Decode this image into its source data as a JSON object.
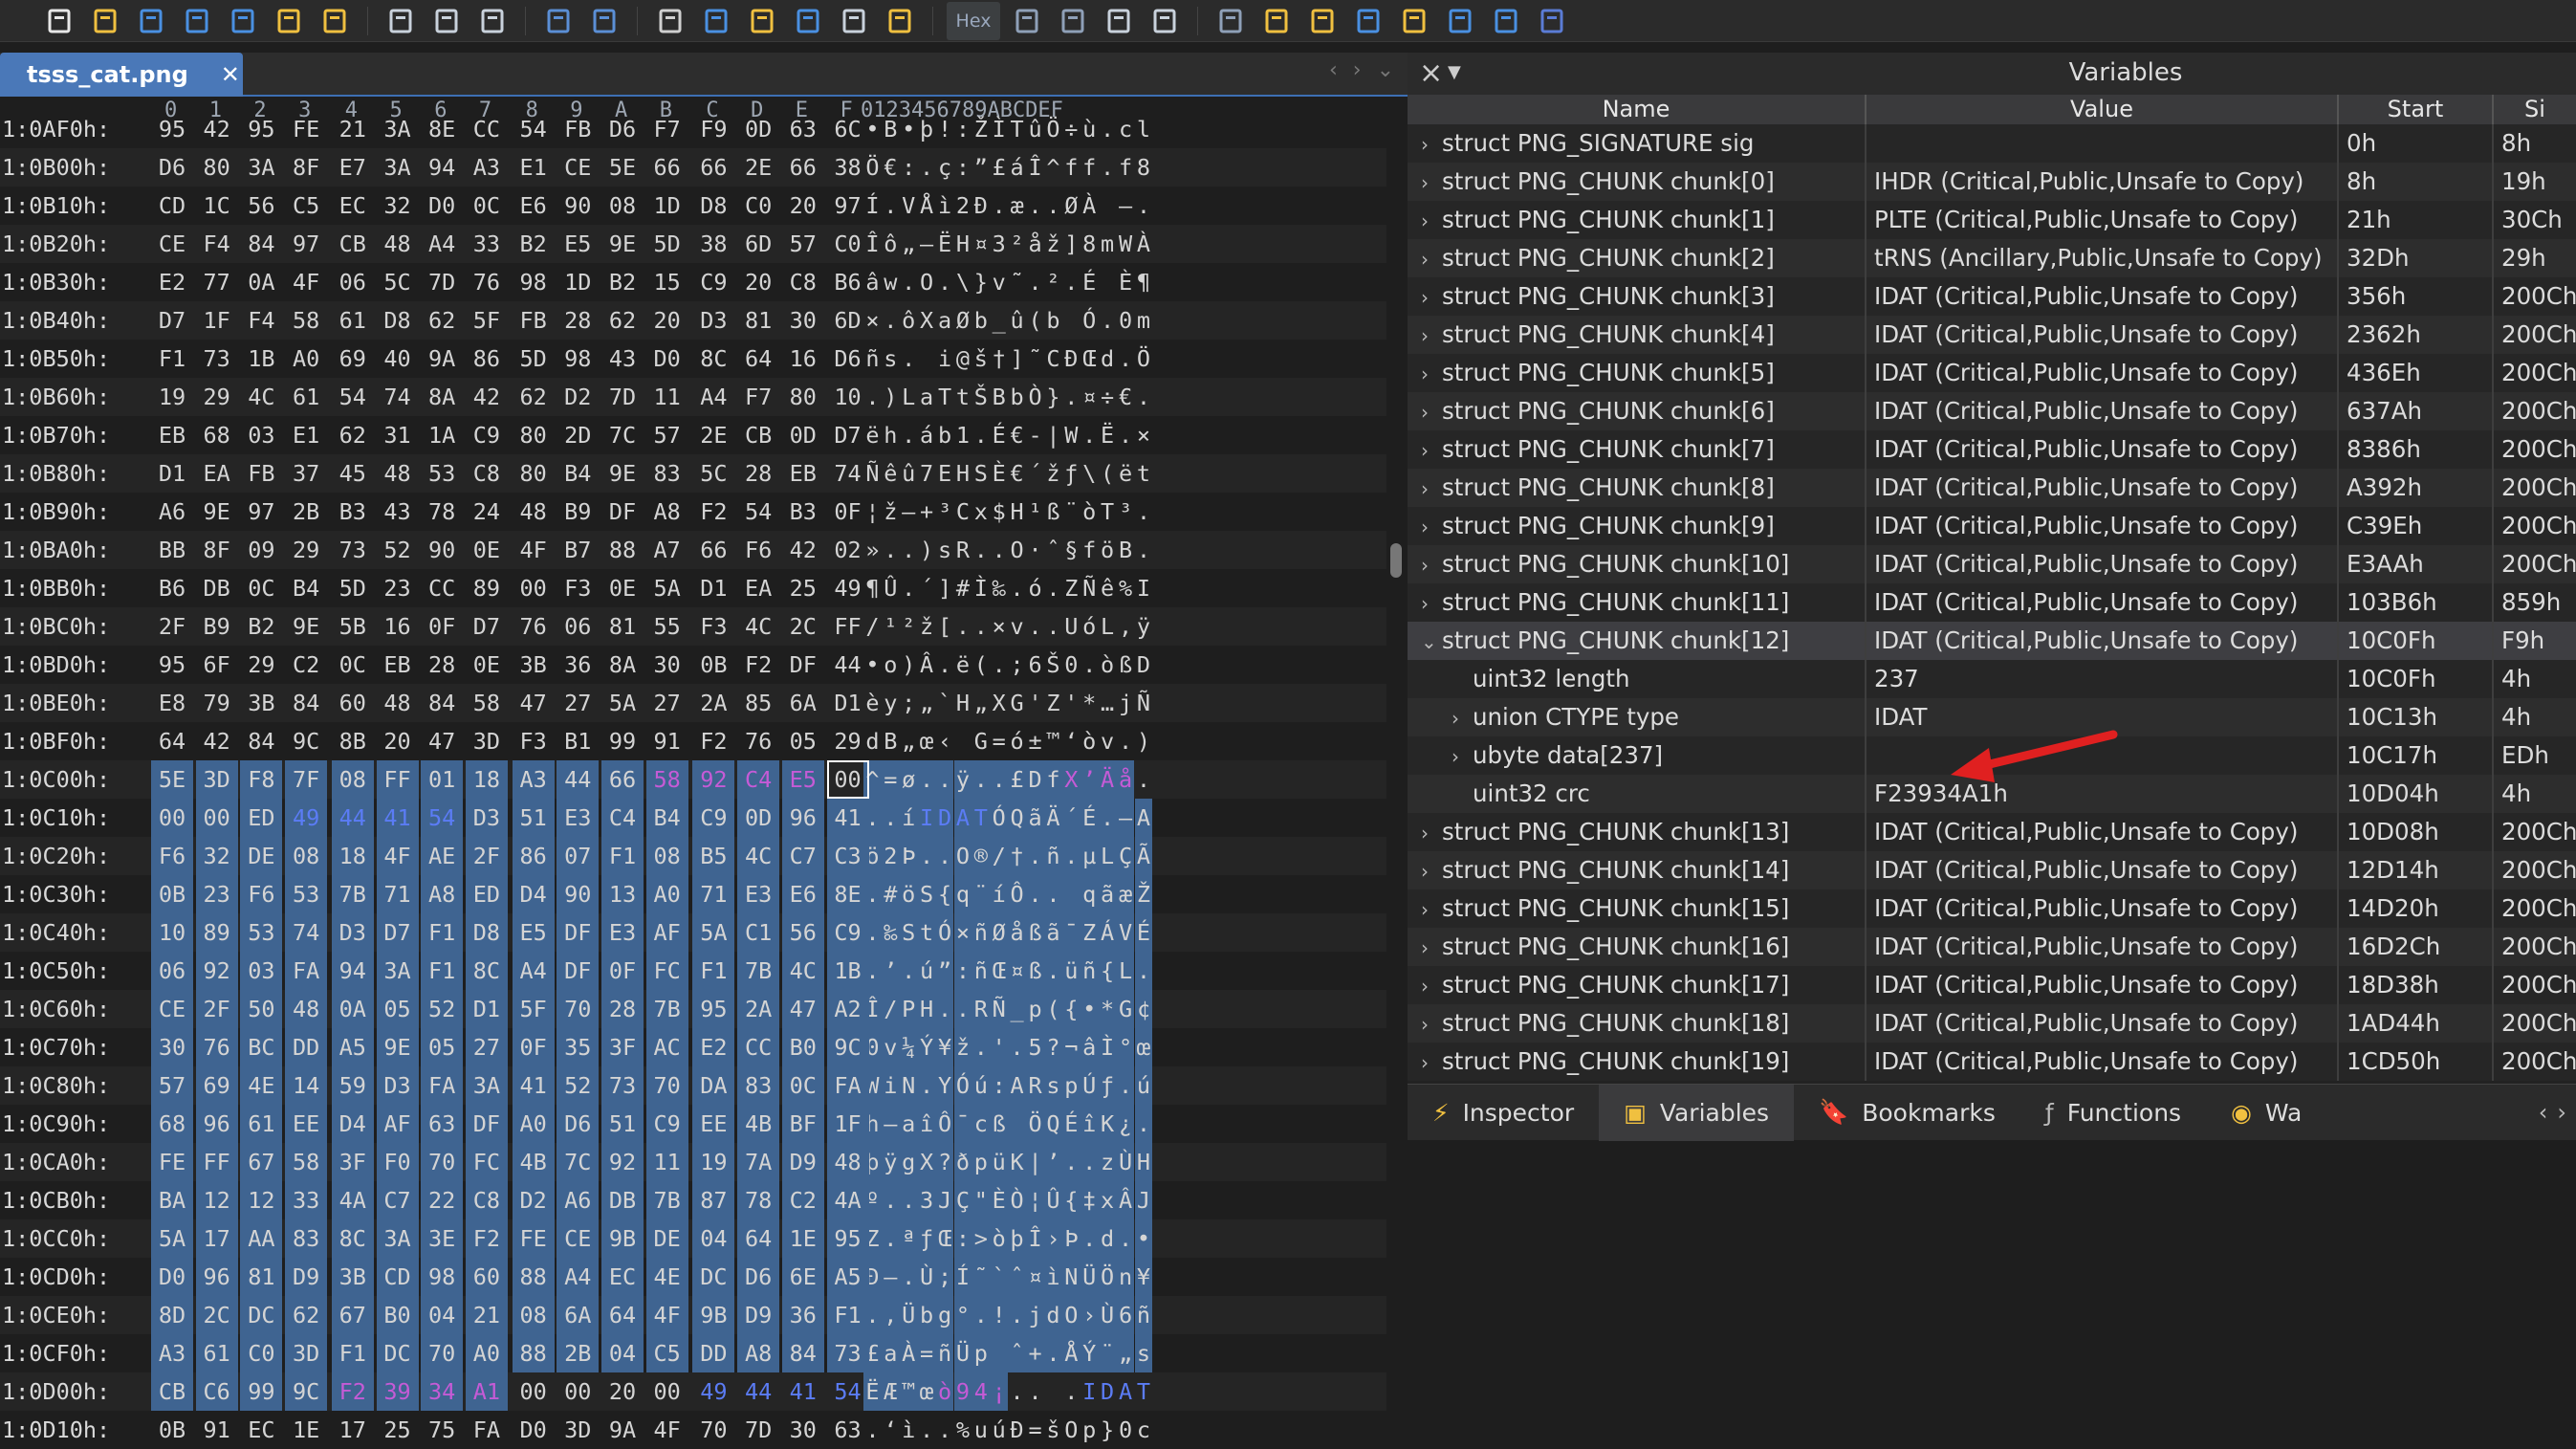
{
  "toolbar": {
    "hex_label": "Hex",
    "icons": [
      "new-file-icon",
      "open-folder-icon",
      "save-icon",
      "save-as-icon",
      "save-all-icon",
      "folder-icon",
      "open-workspace-icon",
      "cut-icon",
      "copy-icon",
      "paste-icon",
      "undo-icon",
      "redo-icon",
      "find-icon",
      "find-replace-icon",
      "find-in-files-icon",
      "goto-icon",
      "bookmark-icon",
      "script-icon",
      "hex-icon",
      "columns-icon",
      "paragraph-icon",
      "table-icon",
      "edit-icon",
      "calculator-icon",
      "inspector-icon",
      "compare-icon",
      "histogram-icon",
      "math-icon",
      "checksum-icon",
      "base-convert-icon",
      "pause-icon"
    ]
  },
  "file_tab": {
    "label": "tsss_cat.png"
  },
  "hex": {
    "col_header": [
      "0",
      "1",
      "2",
      "3",
      "4",
      "5",
      "6",
      "7",
      "8",
      "9",
      "A",
      "B",
      "C",
      "D",
      "E",
      "F"
    ],
    "ascii_header": "0123456789ABCDEF",
    "rows": [
      {
        "addr": "1:0AF0h:",
        "bytes": [
          "95",
          "42",
          "95",
          "FE",
          "21",
          "3A",
          "8E",
          "CC",
          "54",
          "FB",
          "D6",
          "F7",
          "F9",
          "0D",
          "63",
          "6C"
        ],
        "ascii": "•B•þ!:ŽÌTûÖ÷ù.cl"
      },
      {
        "addr": "1:0B00h:",
        "bytes": [
          "D6",
          "80",
          "3A",
          "8F",
          "E7",
          "3A",
          "94",
          "A3",
          "E1",
          "CE",
          "5E",
          "66",
          "66",
          "2E",
          "66",
          "38"
        ],
        "ascii": "Ö€:.ç:”£áÎ^ff.f8"
      },
      {
        "addr": "1:0B10h:",
        "bytes": [
          "CD",
          "1C",
          "56",
          "C5",
          "EC",
          "32",
          "D0",
          "0C",
          "E6",
          "90",
          "08",
          "1D",
          "D8",
          "C0",
          "20",
          "97"
        ],
        "ascii": "Í.VÅì2Ð.æ..ØÀ —"
      },
      {
        "addr": "1:0B20h:",
        "bytes": [
          "CE",
          "F4",
          "84",
          "97",
          "CB",
          "48",
          "A4",
          "33",
          "B2",
          "E5",
          "9E",
          "5D",
          "38",
          "6D",
          "57",
          "C0"
        ],
        "ascii": "Îô„—ËH¤3²åž]8mWÀ"
      },
      {
        "addr": "1:0B30h:",
        "bytes": [
          "E2",
          "77",
          "0A",
          "4F",
          "06",
          "5C",
          "7D",
          "76",
          "98",
          "1D",
          "B2",
          "15",
          "C9",
          "20",
          "C8",
          "B6"
        ],
        "ascii": "âw.O.\\}v˜.².É È¶"
      },
      {
        "addr": "1:0B40h:",
        "bytes": [
          "D7",
          "1F",
          "F4",
          "58",
          "61",
          "D8",
          "62",
          "5F",
          "FB",
          "28",
          "62",
          "20",
          "D3",
          "81",
          "30",
          "6D"
        ],
        "ascii": "×.ôXaØb_û(b Ó.0m"
      },
      {
        "addr": "1:0B50h:",
        "bytes": [
          "F1",
          "73",
          "1B",
          "A0",
          "69",
          "40",
          "9A",
          "86",
          "5D",
          "98",
          "43",
          "D0",
          "8C",
          "64",
          "16",
          "D6"
        ],
        "ascii": "ñs. i@š†]˜CÐŒd.Ö"
      },
      {
        "addr": "1:0B60h:",
        "bytes": [
          "19",
          "29",
          "4C",
          "61",
          "54",
          "74",
          "8A",
          "42",
          "62",
          "D2",
          "7D",
          "11",
          "A4",
          "F7",
          "80",
          "10"
        ],
        "ascii": ".)LaTtŠBbÒ}.¤÷€."
      },
      {
        "addr": "1:0B70h:",
        "bytes": [
          "EB",
          "68",
          "03",
          "E1",
          "62",
          "31",
          "1A",
          "C9",
          "80",
          "2D",
          "7C",
          "57",
          "2E",
          "CB",
          "0D",
          "D7"
        ],
        "ascii": "ëh.áb1.É€-|W.Ë.×"
      },
      {
        "addr": "1:0B80h:",
        "bytes": [
          "D1",
          "EA",
          "FB",
          "37",
          "45",
          "48",
          "53",
          "C8",
          "80",
          "B4",
          "9E",
          "83",
          "5C",
          "28",
          "EB",
          "74"
        ],
        "ascii": "Ñêû7EHSÈ€´žƒ\\(ët"
      },
      {
        "addr": "1:0B90h:",
        "bytes": [
          "A6",
          "9E",
          "97",
          "2B",
          "B3",
          "43",
          "78",
          "24",
          "48",
          "B9",
          "DF",
          "A8",
          "F2",
          "54",
          "B3",
          "0F"
        ],
        "ascii": "¦ž—+³Cx$H¹ß¨òT³."
      },
      {
        "addr": "1:0BA0h:",
        "bytes": [
          "BB",
          "8F",
          "09",
          "29",
          "73",
          "52",
          "90",
          "0E",
          "4F",
          "B7",
          "88",
          "A7",
          "66",
          "F6",
          "42",
          "02"
        ],
        "ascii": "»..)sR..O·ˆ§föB."
      },
      {
        "addr": "1:0BB0h:",
        "bytes": [
          "B6",
          "DB",
          "0C",
          "B4",
          "5D",
          "23",
          "CC",
          "89",
          "00",
          "F3",
          "0E",
          "5A",
          "D1",
          "EA",
          "25",
          "49"
        ],
        "ascii": "¶Û.´]#Ì‰.ó.ZÑê%I"
      },
      {
        "addr": "1:0BC0h:",
        "bytes": [
          "2F",
          "B9",
          "B2",
          "9E",
          "5B",
          "16",
          "0F",
          "D7",
          "76",
          "06",
          "81",
          "55",
          "F3",
          "4C",
          "2C",
          "FF"
        ],
        "ascii": "/¹²ž[..×v..UóL,ÿ"
      },
      {
        "addr": "1:0BD0h:",
        "bytes": [
          "95",
          "6F",
          "29",
          "C2",
          "0C",
          "EB",
          "28",
          "0E",
          "3B",
          "36",
          "8A",
          "30",
          "0B",
          "F2",
          "DF",
          "44"
        ],
        "ascii": "•o)Â.ë(.;6Š0.òßD"
      },
      {
        "addr": "1:0BE0h:",
        "bytes": [
          "E8",
          "79",
          "3B",
          "84",
          "60",
          "48",
          "84",
          "58",
          "47",
          "27",
          "5A",
          "27",
          "2A",
          "85",
          "6A",
          "D1"
        ],
        "ascii": "èy;„`H„XG'Z'*…jÑ"
      },
      {
        "addr": "1:0BF0h:",
        "bytes": [
          "64",
          "42",
          "84",
          "9C",
          "8B",
          "20",
          "47",
          "3D",
          "F3",
          "B1",
          "99",
          "91",
          "F2",
          "76",
          "05",
          "29"
        ],
        "ascii": "dB„œ‹ G=ó±™‘òv.)"
      },
      {
        "addr": "1:0C00h:",
        "bytes": [
          "5E",
          "3D",
          "F8",
          "7F",
          "08",
          "FF",
          "01",
          "18",
          "A3",
          "44",
          "66",
          "58",
          "92",
          "C4",
          "E5",
          "00"
        ],
        "ascii": "^=ø..ÿ..£DfX’Äå."
      },
      {
        "addr": "1:0C10h:",
        "bytes": [
          "00",
          "00",
          "ED",
          "49",
          "44",
          "41",
          "54",
          "D3",
          "51",
          "E3",
          "C4",
          "B4",
          "C9",
          "0D",
          "96",
          "41"
        ],
        "ascii": "..íIDATÓQãÄ´É.–A"
      },
      {
        "addr": "1:0C20h:",
        "bytes": [
          "F6",
          "32",
          "DE",
          "08",
          "18",
          "4F",
          "AE",
          "2F",
          "86",
          "07",
          "F1",
          "08",
          "B5",
          "4C",
          "C7",
          "C3"
        ],
        "ascii": "ö2Þ..O®/†.ñ.µLÇÃ"
      },
      {
        "addr": "1:0C30h:",
        "bytes": [
          "0B",
          "23",
          "F6",
          "53",
          "7B",
          "71",
          "A8",
          "ED",
          "D4",
          "90",
          "13",
          "A0",
          "71",
          "E3",
          "E6",
          "8E"
        ],
        "ascii": ".#öS{q¨íÔ.. qãæŽ"
      },
      {
        "addr": "1:0C40h:",
        "bytes": [
          "10",
          "89",
          "53",
          "74",
          "D3",
          "D7",
          "F1",
          "D8",
          "E5",
          "DF",
          "E3",
          "AF",
          "5A",
          "C1",
          "56",
          "C9"
        ],
        "ascii": ".‰StÓ×ñØåßã¯ZÁVÉ"
      },
      {
        "addr": "1:0C50h:",
        "bytes": [
          "06",
          "92",
          "03",
          "FA",
          "94",
          "3A",
          "F1",
          "8C",
          "A4",
          "DF",
          "0F",
          "FC",
          "F1",
          "7B",
          "4C",
          "1B"
        ],
        "ascii": ".’.ú”:ñŒ¤ß.üñ{L."
      },
      {
        "addr": "1:0C60h:",
        "bytes": [
          "CE",
          "2F",
          "50",
          "48",
          "0A",
          "05",
          "52",
          "D1",
          "5F",
          "70",
          "28",
          "7B",
          "95",
          "2A",
          "47",
          "A2"
        ],
        "ascii": "Î/PH..RÑ_p({•*G¢"
      },
      {
        "addr": "1:0C70h:",
        "bytes": [
          "30",
          "76",
          "BC",
          "DD",
          "A5",
          "9E",
          "05",
          "27",
          "0F",
          "35",
          "3F",
          "AC",
          "E2",
          "CC",
          "B0",
          "9C"
        ],
        "ascii": "0v¼Ý¥ž.'.5?¬âÌ°œ"
      },
      {
        "addr": "1:0C80h:",
        "bytes": [
          "57",
          "69",
          "4E",
          "14",
          "59",
          "D3",
          "FA",
          "3A",
          "41",
          "52",
          "73",
          "70",
          "DA",
          "83",
          "0C",
          "FA"
        ],
        "ascii": "WiN.YÓú:ARspÚƒ.ú"
      },
      {
        "addr": "1:0C90h:",
        "bytes": [
          "68",
          "96",
          "61",
          "EE",
          "D4",
          "AF",
          "63",
          "DF",
          "A0",
          "D6",
          "51",
          "C9",
          "EE",
          "4B",
          "BF",
          "1F"
        ],
        "ascii": "h–aîÔ¯cß ÖQÉîK¿."
      },
      {
        "addr": "1:0CA0h:",
        "bytes": [
          "FE",
          "FF",
          "67",
          "58",
          "3F",
          "F0",
          "70",
          "FC",
          "4B",
          "7C",
          "92",
          "11",
          "19",
          "7A",
          "D9",
          "48"
        ],
        "ascii": "þÿgX?ðpüK|’..zÙH"
      },
      {
        "addr": "1:0CB0h:",
        "bytes": [
          "BA",
          "12",
          "12",
          "33",
          "4A",
          "C7",
          "22",
          "C8",
          "D2",
          "A6",
          "DB",
          "7B",
          "87",
          "78",
          "C2",
          "4A"
        ],
        "ascii": "º..3JÇ\"ÈÒ¦Û{‡xÂJ"
      },
      {
        "addr": "1:0CC0h:",
        "bytes": [
          "5A",
          "17",
          "AA",
          "83",
          "8C",
          "3A",
          "3E",
          "F2",
          "FE",
          "CE",
          "9B",
          "DE",
          "04",
          "64",
          "1E",
          "95"
        ],
        "ascii": "Z.ªƒŒ:>òþÎ›Þ.d.•"
      },
      {
        "addr": "1:0CD0h:",
        "bytes": [
          "D0",
          "96",
          "81",
          "D9",
          "3B",
          "CD",
          "98",
          "60",
          "88",
          "A4",
          "EC",
          "4E",
          "DC",
          "D6",
          "6E",
          "A5"
        ],
        "ascii": "Ð–.Ù;Í˜`ˆ¤ìNÜÖn¥"
      },
      {
        "addr": "1:0CE0h:",
        "bytes": [
          "8D",
          "2C",
          "DC",
          "62",
          "67",
          "B0",
          "04",
          "21",
          "08",
          "6A",
          "64",
          "4F",
          "9B",
          "D9",
          "36",
          "F1"
        ],
        "ascii": ".,Übg°.!.jdO›Ù6ñ"
      },
      {
        "addr": "1:0CF0h:",
        "bytes": [
          "A3",
          "61",
          "C0",
          "3D",
          "F1",
          "DC",
          "70",
          "A0",
          "88",
          "2B",
          "04",
          "C5",
          "DD",
          "A8",
          "84",
          "73"
        ],
        "ascii": "£aÀ=ñÜp ˆ+.ÅÝ¨„s"
      },
      {
        "addr": "1:0D00h:",
        "bytes": [
          "CB",
          "C6",
          "99",
          "9C",
          "F2",
          "39",
          "34",
          "A1",
          "00",
          "00",
          "20",
          "00",
          "49",
          "44",
          "41",
          "54"
        ],
        "ascii": "ËÆ™œò94¡.. .IDAT"
      },
      {
        "addr": "1:0D10h:",
        "bytes": [
          "0B",
          "91",
          "EC",
          "1E",
          "17",
          "25",
          "75",
          "FA",
          "D0",
          "3D",
          "9A",
          "4F",
          "70",
          "7D",
          "30",
          "63"
        ],
        "ascii": ".‘ì..%uúÐ=šOp}0c"
      }
    ]
  },
  "variables": {
    "title": "Variables",
    "columns": {
      "name": "Name",
      "value": "Value",
      "start": "Start",
      "size": "Si"
    },
    "rows": [
      {
        "name": "struct PNG_SIGNATURE sig",
        "value": "",
        "start": "0h",
        "size": "8h",
        "chev": "›",
        "indent": 0
      },
      {
        "name": "struct PNG_CHUNK chunk[0]",
        "value": "IHDR  (Critical,Public,Unsafe to Copy)",
        "start": "8h",
        "size": "19h",
        "chev": "›",
        "indent": 0
      },
      {
        "name": "struct PNG_CHUNK chunk[1]",
        "value": "PLTE  (Critical,Public,Unsafe to Copy)",
        "start": "21h",
        "size": "30Ch",
        "chev": "›",
        "indent": 0
      },
      {
        "name": "struct PNG_CHUNK chunk[2]",
        "value": "tRNS  (Ancillary,Public,Unsafe to Copy)",
        "start": "32Dh",
        "size": "29h",
        "chev": "›",
        "indent": 0
      },
      {
        "name": "struct PNG_CHUNK chunk[3]",
        "value": "IDAT  (Critical,Public,Unsafe to Copy)",
        "start": "356h",
        "size": "200Ch",
        "chev": "›",
        "indent": 0
      },
      {
        "name": "struct PNG_CHUNK chunk[4]",
        "value": "IDAT  (Critical,Public,Unsafe to Copy)",
        "start": "2362h",
        "size": "200Ch",
        "chev": "›",
        "indent": 0
      },
      {
        "name": "struct PNG_CHUNK chunk[5]",
        "value": "IDAT  (Critical,Public,Unsafe to Copy)",
        "start": "436Eh",
        "size": "200Ch",
        "chev": "›",
        "indent": 0
      },
      {
        "name": "struct PNG_CHUNK chunk[6]",
        "value": "IDAT  (Critical,Public,Unsafe to Copy)",
        "start": "637Ah",
        "size": "200Ch",
        "chev": "›",
        "indent": 0
      },
      {
        "name": "struct PNG_CHUNK chunk[7]",
        "value": "IDAT  (Critical,Public,Unsafe to Copy)",
        "start": "8386h",
        "size": "200Ch",
        "chev": "›",
        "indent": 0
      },
      {
        "name": "struct PNG_CHUNK chunk[8]",
        "value": "IDAT  (Critical,Public,Unsafe to Copy)",
        "start": "A392h",
        "size": "200Ch",
        "chev": "›",
        "indent": 0
      },
      {
        "name": "struct PNG_CHUNK chunk[9]",
        "value": "IDAT  (Critical,Public,Unsafe to Copy)",
        "start": "C39Eh",
        "size": "200Ch",
        "chev": "›",
        "indent": 0
      },
      {
        "name": "struct PNG_CHUNK chunk[10]",
        "value": "IDAT  (Critical,Public,Unsafe to Copy)",
        "start": "E3AAh",
        "size": "200Ch",
        "chev": "›",
        "indent": 0
      },
      {
        "name": "struct PNG_CHUNK chunk[11]",
        "value": "IDAT  (Critical,Public,Unsafe to Copy)",
        "start": "103B6h",
        "size": "859h",
        "chev": "›",
        "indent": 0
      },
      {
        "name": "struct PNG_CHUNK chunk[12]",
        "value": "IDAT  (Critical,Public,Unsafe to Copy)",
        "start": "10C0Fh",
        "size": "F9h",
        "chev": "⌄",
        "indent": 0,
        "expanded": true
      },
      {
        "name": "uint32 length",
        "value": "237",
        "start": "10C0Fh",
        "size": "4h",
        "chev": "",
        "indent": 1
      },
      {
        "name": "union CTYPE type",
        "value": "IDAT",
        "start": "10C13h",
        "size": "4h",
        "chev": "›",
        "indent": 1
      },
      {
        "name": "ubyte data[237]",
        "value": "",
        "start": "10C17h",
        "size": "EDh",
        "chev": "›",
        "indent": 1
      },
      {
        "name": "uint32 crc",
        "value": "F23934A1h",
        "start": "10D04h",
        "size": "4h",
        "chev": "",
        "indent": 1
      },
      {
        "name": "struct PNG_CHUNK chunk[13]",
        "value": "IDAT  (Critical,Public,Unsafe to Copy)",
        "start": "10D08h",
        "size": "200Ch",
        "chev": "›",
        "indent": 0
      },
      {
        "name": "struct PNG_CHUNK chunk[14]",
        "value": "IDAT  (Critical,Public,Unsafe to Copy)",
        "start": "12D14h",
        "size": "200Ch",
        "chev": "›",
        "indent": 0
      },
      {
        "name": "struct PNG_CHUNK chunk[15]",
        "value": "IDAT  (Critical,Public,Unsafe to Copy)",
        "start": "14D20h",
        "size": "200Ch",
        "chev": "›",
        "indent": 0
      },
      {
        "name": "struct PNG_CHUNK chunk[16]",
        "value": "IDAT  (Critical,Public,Unsafe to Copy)",
        "start": "16D2Ch",
        "size": "200Ch",
        "chev": "›",
        "indent": 0
      },
      {
        "name": "struct PNG_CHUNK chunk[17]",
        "value": "IDAT  (Critical,Public,Unsafe to Copy)",
        "start": "18D38h",
        "size": "200Ch",
        "chev": "›",
        "indent": 0
      },
      {
        "name": "struct PNG_CHUNK chunk[18]",
        "value": "IDAT  (Critical,Public,Unsafe to Copy)",
        "start": "1AD44h",
        "size": "200Ch",
        "chev": "›",
        "indent": 0
      },
      {
        "name": "struct PNG_CHUNK chunk[19]",
        "value": "IDAT  (Critical,Public,Unsafe to Copy)",
        "start": "1CD50h",
        "size": "200Ch",
        "chev": "›",
        "indent": 0
      }
    ]
  },
  "bottom_tabs": [
    {
      "label": "Inspector",
      "icon": "lightning-icon",
      "active": false
    },
    {
      "label": "Variables",
      "icon": "variables-icon",
      "active": true
    },
    {
      "label": "Bookmarks",
      "icon": "bookmark-icon",
      "active": false
    },
    {
      "label": "Functions",
      "icon": "function-icon",
      "active": false
    },
    {
      "label": "Wa",
      "icon": "eye-icon",
      "active": false
    }
  ],
  "colors": {
    "selection": "#3f6491",
    "accent": "#4a78b8",
    "magenta": "#c55bd6",
    "blue_text": "#5b7cf5",
    "annotation_arrow": "#e02020"
  }
}
